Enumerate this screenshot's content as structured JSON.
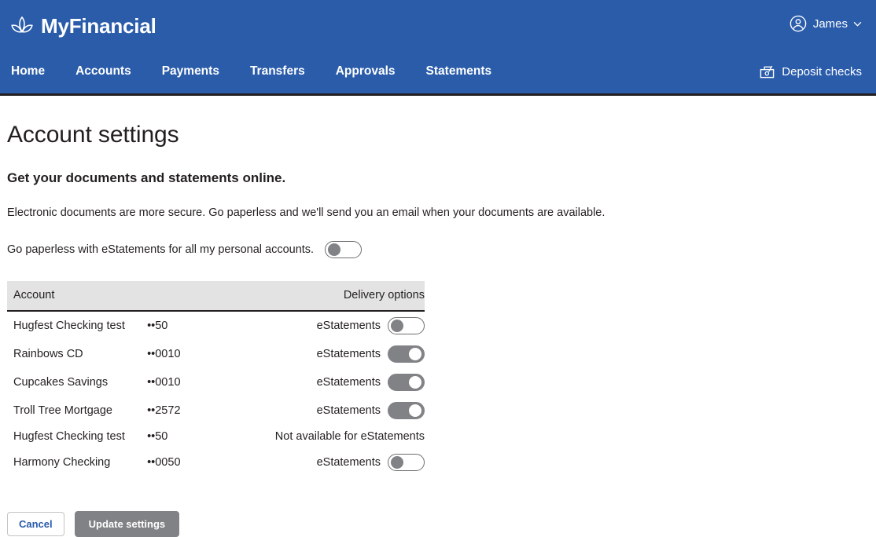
{
  "header": {
    "brand_name": "MyFinancial",
    "logo_icon": "lotus-flower-icon",
    "user": {
      "name": "James",
      "avatar_icon": "user-circle-icon",
      "chevron_icon": "chevron-down-icon"
    },
    "nav_items": [
      {
        "label": "Home"
      },
      {
        "label": "Accounts"
      },
      {
        "label": "Payments"
      },
      {
        "label": "Transfers"
      },
      {
        "label": "Approvals"
      },
      {
        "label": "Statements"
      }
    ],
    "deposit": {
      "label": "Deposit checks",
      "icon": "deposit-check-camera-icon"
    },
    "background_color": "#2a5caa"
  },
  "main": {
    "page_title": "Account settings",
    "section_heading": "Get your documents and statements online.",
    "intro_text": "Electronic documents are more secure. Go paperless and we'll send you an email when your documents are available.",
    "paperless": {
      "label": "Go paperless with eStatements for all my personal accounts.",
      "toggle_state": "off"
    },
    "table": {
      "columns": {
        "account": "Account",
        "delivery": "Delivery options"
      },
      "rows": [
        {
          "name": "Hugfest Checking test",
          "number": "••50",
          "delivery_label": "eStatements",
          "toggle_state": "off",
          "available": true
        },
        {
          "name": "Rainbows CD",
          "number": "••0010",
          "delivery_label": "eStatements",
          "toggle_state": "on",
          "available": true
        },
        {
          "name": "Cupcakes Savings",
          "number": "••0010",
          "delivery_label": "eStatements",
          "toggle_state": "on",
          "available": true
        },
        {
          "name": "Troll Tree Mortgage",
          "number": "••2572",
          "delivery_label": "eStatements",
          "toggle_state": "on",
          "available": true
        },
        {
          "name": "Hugfest Checking test",
          "number": "••50",
          "delivery_label": "Not available for eStatements",
          "toggle_state": "none",
          "available": false
        },
        {
          "name": "Harmony Checking",
          "number": "••0050",
          "delivery_label": "eStatements",
          "toggle_state": "off",
          "available": true
        }
      ]
    },
    "buttons": {
      "cancel": "Cancel",
      "update": "Update settings"
    }
  },
  "colors": {
    "brand_blue": "#2a5caa",
    "toggle_gray": "#808285",
    "table_header_gray": "#e3e3e3",
    "text_dark": "#231f20"
  }
}
